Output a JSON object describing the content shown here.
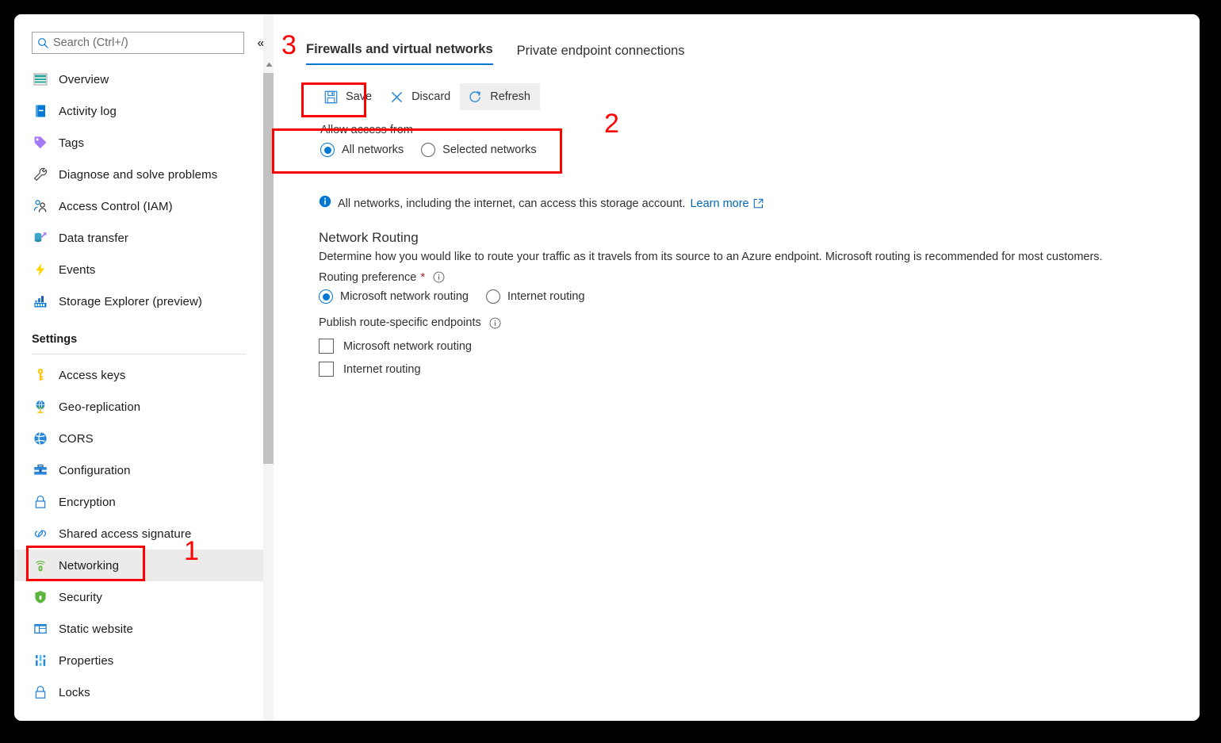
{
  "search": {
    "placeholder": "Search (Ctrl+/)",
    "value": "",
    "collapse_glyph": "«"
  },
  "sidebar": {
    "items": [
      {
        "label": "Overview",
        "icon": "overview-icon"
      },
      {
        "label": "Activity log",
        "icon": "activity-log-icon"
      },
      {
        "label": "Tags",
        "icon": "tags-icon"
      },
      {
        "label": "Diagnose and solve problems",
        "icon": "wrench-icon"
      },
      {
        "label": "Access Control (IAM)",
        "icon": "access-control-icon"
      },
      {
        "label": "Data transfer",
        "icon": "data-transfer-icon"
      },
      {
        "label": "Events",
        "icon": "events-icon"
      },
      {
        "label": "Storage Explorer (preview)",
        "icon": "storage-explorer-icon"
      }
    ],
    "settings_header": "Settings",
    "settings_items": [
      {
        "label": "Access keys",
        "icon": "key-icon"
      },
      {
        "label": "Geo-replication",
        "icon": "globe-icon"
      },
      {
        "label": "CORS",
        "icon": "cors-icon"
      },
      {
        "label": "Configuration",
        "icon": "configuration-icon"
      },
      {
        "label": "Encryption",
        "icon": "lock-icon"
      },
      {
        "label": "Shared access signature",
        "icon": "link-icon"
      },
      {
        "label": "Networking",
        "icon": "networking-icon",
        "selected": true
      },
      {
        "label": "Security",
        "icon": "shield-icon"
      },
      {
        "label": "Static website",
        "icon": "static-website-icon"
      },
      {
        "label": "Properties",
        "icon": "properties-icon"
      },
      {
        "label": "Locks",
        "icon": "lock-icon"
      }
    ]
  },
  "main": {
    "tabs": [
      {
        "label": "Firewalls and virtual networks",
        "active": true
      },
      {
        "label": "Private endpoint connections",
        "active": false
      }
    ],
    "toolbar": [
      {
        "label": "Save",
        "icon": "save-icon"
      },
      {
        "label": "Discard",
        "icon": "discard-icon"
      },
      {
        "label": "Refresh",
        "icon": "refresh-icon"
      }
    ],
    "access": {
      "label": "Allow access from",
      "options": [
        {
          "label": "All networks",
          "checked": true
        },
        {
          "label": "Selected networks",
          "checked": false
        }
      ]
    },
    "info": {
      "text": "All networks, including the internet, can access this storage account.",
      "link": "Learn more"
    },
    "routing": {
      "heading": "Network Routing",
      "description": "Determine how you would like to route your traffic as it travels from its source to an Azure endpoint. Microsoft routing is recommended for most customers.",
      "preference_label": "Routing preference",
      "required_marker": "*",
      "preference_options": [
        {
          "label": "Microsoft network routing",
          "checked": true
        },
        {
          "label": "Internet routing",
          "checked": false
        }
      ],
      "publish_label": "Publish route-specific endpoints",
      "publish_options": [
        {
          "label": "Microsoft network routing",
          "checked": false
        },
        {
          "label": "Internet routing",
          "checked": false
        }
      ]
    }
  },
  "annotations": {
    "one": "1",
    "two": "2",
    "three": "3",
    "color": "#ff0000"
  },
  "colors": {
    "accent": "#0078d4",
    "link": "#0067b8",
    "selected_row": "#edebe9",
    "text": "#323130",
    "required": "#a4262c"
  }
}
